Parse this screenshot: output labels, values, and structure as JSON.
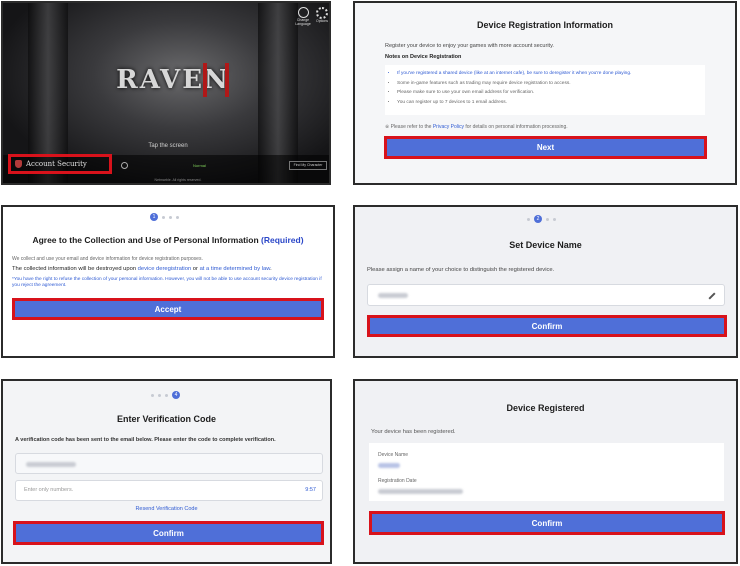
{
  "game_panel": {
    "icons": {
      "language_label": "Change Language",
      "options_label": "Options"
    },
    "logo_text": "RAVEN",
    "center_caption": "Tap the screen",
    "server_status": "Normal",
    "find_character": "Find My Character",
    "account_security": "Account Security",
    "copyright": "Netmarble. All rights reserved."
  },
  "device_info": {
    "title": "Device Registration Information",
    "intro": "Register your device to enjoy your games with more account security.",
    "notes_title": "Notes on Device Registration",
    "notes": [
      "If you've registered a shared device (like at an internet cafe), be sure to deregister it when you're done playing.",
      "Some in-game features such as trading may require device registration to access.",
      "Please make sure to use your own email address for verification.",
      "You can register up to 7 devices to 1 email address."
    ],
    "privacy_prefix": "※ Please refer to the ",
    "privacy_link": "Privacy Policy",
    "privacy_suffix": " for details on personal information processing.",
    "next_label": "Next"
  },
  "agree": {
    "title": "Agree to the Collection and Use of Personal Information",
    "required": "(Required)",
    "line1": "We collect and use your email and device information for device registration purposes.",
    "line2_prefix": "The collected information will be destroyed upon ",
    "line2_link1": "device deregistration",
    "line2_mid": " or ",
    "line2_link2": "at a time determined by law",
    "line2_suffix": ".",
    "note": "*You have the right to refuse the collection of your personal information. However, you will not be able to use account security device registration if you reject the agreement.",
    "accept_label": "Accept",
    "step_active": "1"
  },
  "device_name": {
    "title": "Set Device Name",
    "intro": "Please assign a name of your choice to distinguish the registered device.",
    "confirm_label": "Confirm",
    "step_active": "2"
  },
  "verify": {
    "title": "Enter Verification Code",
    "intro": "A verification code has been sent to the email below. Please enter the code to complete verification.",
    "placeholder": "Enter only numbers.",
    "timer": "9:57",
    "resend": "Resend Verification Code",
    "confirm_label": "Confirm",
    "step_active": "4"
  },
  "registered": {
    "title": "Device Registered",
    "intro": "Your device has been registered.",
    "name_label": "Device Name",
    "date_label": "Registration Date",
    "confirm_label": "Confirm"
  },
  "colors": {
    "accent": "#4f6fd8",
    "highlight": "#d8121b",
    "link": "#2f5bd3"
  }
}
